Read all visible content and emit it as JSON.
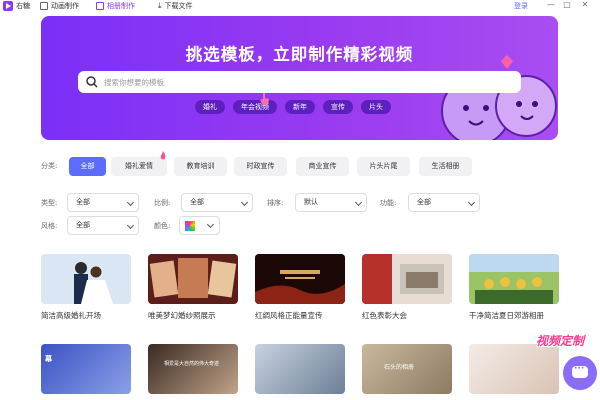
{
  "topbar": {
    "logo": "右糖",
    "nav": [
      "动画制作",
      "相册制作",
      "下载文件"
    ],
    "login": "登录",
    "window_buttons": [
      "—",
      "□",
      "✕"
    ]
  },
  "banner": {
    "title": "挑选模板，立即制作精彩视频",
    "search_placeholder": "搜索你想要的模板",
    "tags": [
      "婚礼",
      "年会视频",
      "新年",
      "宣传",
      "片头"
    ]
  },
  "filters": {
    "category_label": "分类:",
    "categories": [
      "全部",
      "婚礼爱情",
      "教育培训",
      "时政宣传",
      "商业宣传",
      "片头片尾",
      "生活相册"
    ],
    "type_label": "类型:",
    "type_value": "全部",
    "ratio_label": "比例:",
    "ratio_value": "全部",
    "sort_label": "排序:",
    "sort_value": "默认",
    "function_label": "功能:",
    "function_value": "全部",
    "style_label": "风格:",
    "style_value": "全部",
    "color_label": "颜色:"
  },
  "templates_row1": [
    {
      "title": "简洁高级婚礼开场",
      "color1": "#c9d8ee",
      "color2": "#f4e9e2"
    },
    {
      "title": "唯美梦幻婚纱照展示",
      "color1": "#7a2a2a",
      "color2": "#d9895b"
    },
    {
      "title": "红绸风格正能量宣传",
      "color1": "#2a0c08",
      "color2": "#6b2a12"
    },
    {
      "title": "红色表彰大会",
      "color1": "#b8302a",
      "color2": "#e9d6c3"
    },
    {
      "title": "干净简洁夏日郊游相册",
      "color1": "#f1c341",
      "color2": "#79a84d"
    }
  ],
  "templates_row2": [
    {
      "title": "",
      "inner": "幕",
      "color1": "#3b52c4",
      "color2": "#8aa0e8"
    },
    {
      "title": "",
      "inner": "相爱是大自然的伟大奇迹",
      "color1": "#3a2a22",
      "color2": "#c1a48a"
    },
    {
      "title": "",
      "inner": "",
      "color1": "#c8d2e0",
      "color2": "#6d7f97"
    },
    {
      "title": "",
      "inner": "石头的相册",
      "color1": "#c9b89e",
      "color2": "#8d7a63"
    },
    {
      "title": "",
      "inner": "",
      "color1": "#f4ece6",
      "color2": "#d9c3b5"
    }
  ],
  "watermark": "视频定制",
  "colors": {
    "accent": "#8a3cf5",
    "primary_blue": "#5b6cff",
    "tag_bg": "#5e1fbf"
  }
}
